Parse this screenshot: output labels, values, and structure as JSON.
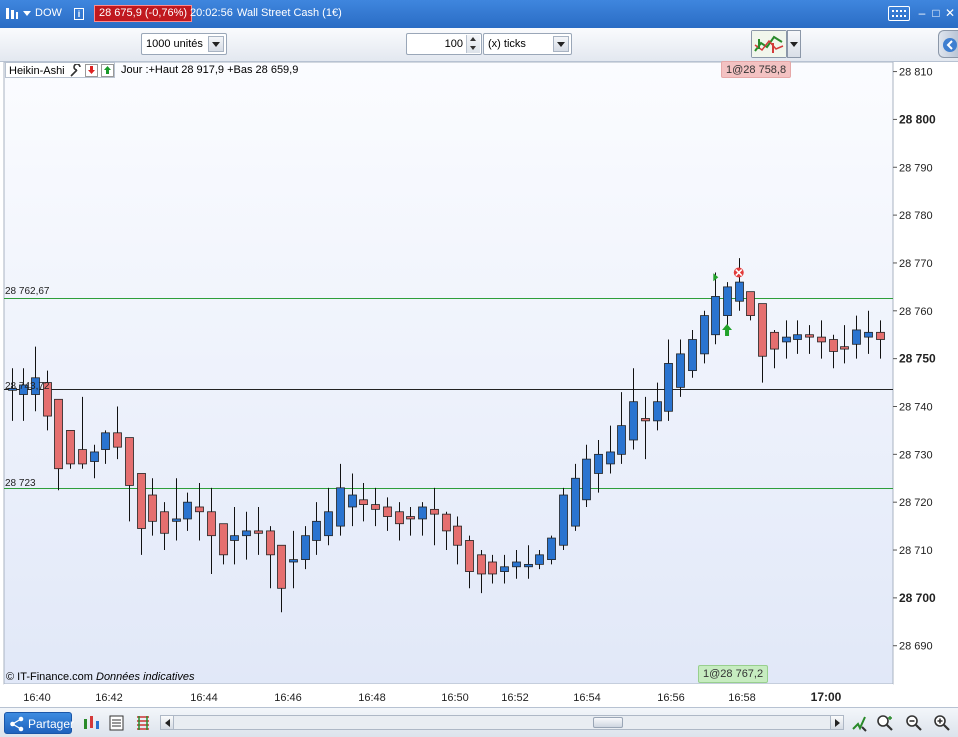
{
  "titlebar": {
    "symbol": "DOW",
    "price_change": "28 675,9 (-0,76%)",
    "time": "20:02:56",
    "instrument": "Wall Street Cash (1€)"
  },
  "toolbar": {
    "units_value": "1000 unités",
    "ticks_value": "100",
    "ticks_unit": "(x) ticks"
  },
  "legend": {
    "chart_style": "Heikin-Ashi",
    "day_info": "Jour :+Haut 28 917,9 +Bas 28 659,9"
  },
  "order_badges": {
    "top": "1@28 758,8",
    "bottom": "1@28 767,2"
  },
  "line_labels": {
    "upper": "28 762,67",
    "middle": "28 743,72",
    "lower": "28 723"
  },
  "footer": {
    "copyright": "© IT-Finance.com",
    "disclaimer": "Données indicatives"
  },
  "bottombar": {
    "share_label": "Partager"
  },
  "colors": {
    "up": "#2a74d0",
    "down": "#e56f6f",
    "level_line": "#2e9e3a",
    "current_line": "#222222",
    "order_top_bg": "#f3c2c2",
    "order_bottom_bg": "#c6ecc0"
  },
  "chart_data": {
    "type": "candlestick",
    "style": "Heikin-Ashi",
    "ylim": [
      28682,
      28812
    ],
    "y_ticks": [
      28810,
      28800,
      28790,
      28780,
      28770,
      28760,
      28750,
      28740,
      28730,
      28720,
      28710,
      28700,
      28690
    ],
    "y_tick_labels": [
      "28 810",
      "28 800",
      "28 790",
      "28 780",
      "28 770",
      "28 760",
      "28 750",
      "28 740",
      "28 730",
      "28 720",
      "28 710",
      "28 700",
      "28 690"
    ],
    "y_bold_ticks": [
      28800,
      28750,
      28700
    ],
    "x_ticks": [
      "16:40",
      "16:42",
      "16:44",
      "16:46",
      "16:48",
      "16:50",
      "16:52",
      "16:54",
      "16:56",
      "16:58",
      "17:00"
    ],
    "x_bold_ticks": [
      "17:00"
    ],
    "horizontal_lines": [
      {
        "value": 28762.67,
        "kind": "level"
      },
      {
        "value": 28743.72,
        "kind": "current"
      },
      {
        "value": 28723,
        "kind": "level"
      }
    ],
    "candles": [
      {
        "open": 28743.5,
        "high": 28748,
        "low": 28737,
        "close": 28743.8
      },
      {
        "open": 28742.5,
        "high": 28748,
        "low": 28737,
        "close": 28744.5
      },
      {
        "open": 28742.5,
        "high": 28752.5,
        "low": 28739,
        "close": 28746
      },
      {
        "open": 28745,
        "high": 28747.5,
        "low": 28735,
        "close": 28738
      },
      {
        "open": 28741.5,
        "high": 28741.5,
        "low": 28722.5,
        "close": 28727
      },
      {
        "open": 28735,
        "high": 28735,
        "low": 28727,
        "close": 28728
      },
      {
        "open": 28731,
        "high": 28742,
        "low": 28727,
        "close": 28728
      },
      {
        "open": 28728.5,
        "high": 28732,
        "low": 28725,
        "close": 28730.5
      },
      {
        "open": 28731,
        "high": 28735,
        "low": 28728,
        "close": 28734.5
      },
      {
        "open": 28734.5,
        "high": 28740,
        "low": 28729,
        "close": 28731.5
      },
      {
        "open": 28733.5,
        "high": 28733.5,
        "low": 28716,
        "close": 28723.5
      },
      {
        "open": 28726,
        "high": 28726,
        "low": 28709,
        "close": 28714.5
      },
      {
        "open": 28721.5,
        "high": 28725,
        "low": 28713,
        "close": 28716
      },
      {
        "open": 28718,
        "high": 28720,
        "low": 28710,
        "close": 28713.5
      },
      {
        "open": 28716,
        "high": 28725,
        "low": 28712,
        "close": 28716.5
      },
      {
        "open": 28716.5,
        "high": 28722,
        "low": 28714,
        "close": 28720
      },
      {
        "open": 28719,
        "high": 28724,
        "low": 28712,
        "close": 28718
      },
      {
        "open": 28718,
        "high": 28723,
        "low": 28705,
        "close": 28713
      },
      {
        "open": 28715.5,
        "high": 28715.5,
        "low": 28707,
        "close": 28709
      },
      {
        "open": 28712,
        "high": 28719,
        "low": 28707,
        "close": 28713
      },
      {
        "open": 28713,
        "high": 28718,
        "low": 28708,
        "close": 28714
      },
      {
        "open": 28714,
        "high": 28719,
        "low": 28709,
        "close": 28713.5
      },
      {
        "open": 28714,
        "high": 28715,
        "low": 28702,
        "close": 28709
      },
      {
        "open": 28711,
        "high": 28711,
        "low": 28697,
        "close": 28702
      },
      {
        "open": 28707.5,
        "high": 28714,
        "low": 28702,
        "close": 28708
      },
      {
        "open": 28708,
        "high": 28715,
        "low": 28706,
        "close": 28713
      },
      {
        "open": 28712,
        "high": 28720,
        "low": 28709,
        "close": 28716
      },
      {
        "open": 28713,
        "high": 28723,
        "low": 28711,
        "close": 28718
      },
      {
        "open": 28715,
        "high": 28728,
        "low": 28713,
        "close": 28723
      },
      {
        "open": 28719,
        "high": 28726,
        "low": 28715,
        "close": 28721.5
      },
      {
        "open": 28720.5,
        "high": 28724,
        "low": 28716,
        "close": 28719.5
      },
      {
        "open": 28719.5,
        "high": 28723,
        "low": 28715,
        "close": 28718.5
      },
      {
        "open": 28719,
        "high": 28721,
        "low": 28714,
        "close": 28717
      },
      {
        "open": 28718,
        "high": 28720,
        "low": 28712,
        "close": 28715.5
      },
      {
        "open": 28717,
        "high": 28719,
        "low": 28713,
        "close": 28716.5
      },
      {
        "open": 28716.5,
        "high": 28720,
        "low": 28713,
        "close": 28719
      },
      {
        "open": 28718.5,
        "high": 28723,
        "low": 28711,
        "close": 28717.5
      },
      {
        "open": 28717.5,
        "high": 28718,
        "low": 28710,
        "close": 28714
      },
      {
        "open": 28715,
        "high": 28717,
        "low": 28707,
        "close": 28711
      },
      {
        "open": 28712,
        "high": 28713,
        "low": 28702,
        "close": 28705.5
      },
      {
        "open": 28709,
        "high": 28710,
        "low": 28701,
        "close": 28705
      },
      {
        "open": 28707.5,
        "high": 28709,
        "low": 28703,
        "close": 28705
      },
      {
        "open": 28705.5,
        "high": 28709,
        "low": 28703,
        "close": 28706.5
      },
      {
        "open": 28706.5,
        "high": 28710,
        "low": 28704,
        "close": 28707.5
      },
      {
        "open": 28706.5,
        "high": 28711,
        "low": 28704,
        "close": 28707
      },
      {
        "open": 28707,
        "high": 28710,
        "low": 28706,
        "close": 28709
      },
      {
        "open": 28708,
        "high": 28713,
        "low": 28707,
        "close": 28712.5
      },
      {
        "open": 28711,
        "high": 28723,
        "low": 28710,
        "close": 28721.5
      },
      {
        "open": 28715,
        "high": 28728,
        "low": 28714,
        "close": 28725
      },
      {
        "open": 28720.5,
        "high": 28732,
        "low": 28719,
        "close": 28729
      },
      {
        "open": 28726,
        "high": 28733,
        "low": 28722,
        "close": 28730
      },
      {
        "open": 28728,
        "high": 28736,
        "low": 28726,
        "close": 28730.5
      },
      {
        "open": 28730,
        "high": 28743,
        "low": 28728,
        "close": 28736
      },
      {
        "open": 28733,
        "high": 28748,
        "low": 28731,
        "close": 28741
      },
      {
        "open": 28737.5,
        "high": 28742,
        "low": 28729,
        "close": 28737
      },
      {
        "open": 28737,
        "high": 28745,
        "low": 28735,
        "close": 28741
      },
      {
        "open": 28739,
        "high": 28754,
        "low": 28737,
        "close": 28749
      },
      {
        "open": 28744,
        "high": 28754,
        "low": 28742,
        "close": 28751
      },
      {
        "open": 28747.5,
        "high": 28756,
        "low": 28746,
        "close": 28754
      },
      {
        "open": 28751,
        "high": 28760,
        "low": 28749,
        "close": 28759
      },
      {
        "open": 28755,
        "high": 28768,
        "low": 28753,
        "close": 28763
      },
      {
        "open": 28759,
        "high": 28766,
        "low": 28757,
        "close": 28765
      },
      {
        "open": 28762,
        "high": 28771,
        "low": 28760,
        "close": 28766
      },
      {
        "open": 28764,
        "high": 28764,
        "low": 28758,
        "close": 28759
      },
      {
        "open": 28761.5,
        "high": 28761.5,
        "low": 28745,
        "close": 28750.5
      },
      {
        "open": 28755.5,
        "high": 28756,
        "low": 28748,
        "close": 28752
      },
      {
        "open": 28753.5,
        "high": 28758,
        "low": 28750,
        "close": 28754.5
      },
      {
        "open": 28754,
        "high": 28758,
        "low": 28751,
        "close": 28755
      },
      {
        "open": 28755,
        "high": 28757,
        "low": 28751,
        "close": 28754.5
      },
      {
        "open": 28754.5,
        "high": 28758,
        "low": 28750,
        "close": 28753.5
      },
      {
        "open": 28754,
        "high": 28755,
        "low": 28748,
        "close": 28751.5
      },
      {
        "open": 28752.5,
        "high": 28757,
        "low": 28749,
        "close": 28752
      },
      {
        "open": 28753,
        "high": 28759,
        "low": 28750,
        "close": 28756
      },
      {
        "open": 28754.5,
        "high": 28760,
        "low": 28751,
        "close": 28755.5
      },
      {
        "open": 28755.5,
        "high": 28758,
        "low": 28750,
        "close": 28754
      }
    ],
    "markers": [
      {
        "candle": 60,
        "value": 28767,
        "kind": "green-triangle"
      },
      {
        "candle": 61,
        "value": 28756,
        "kind": "green-up-arrow"
      },
      {
        "candle": 62,
        "value": 28768,
        "kind": "red-x"
      }
    ]
  }
}
